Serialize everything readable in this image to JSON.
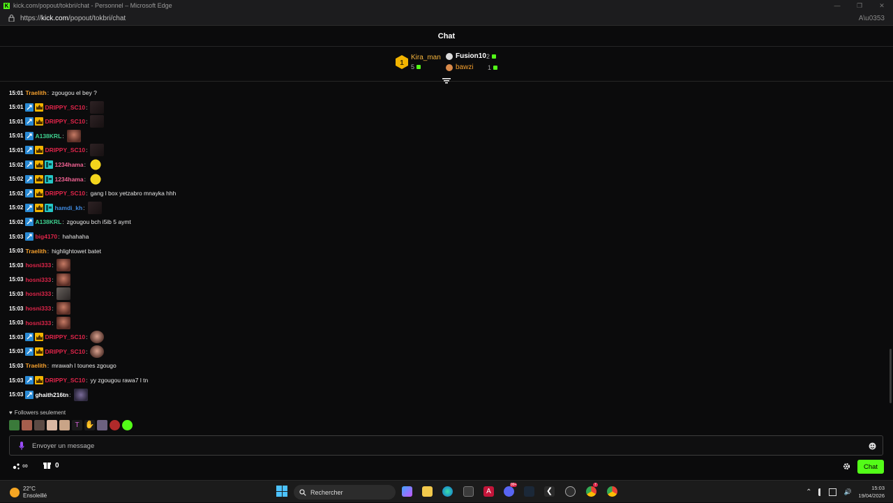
{
  "browser": {
    "title": "kick.com/popout/tokbri/chat - Personnel – Microsoft Edge",
    "url_prefix": "https://",
    "url_host": "kick.com",
    "url_path": "/popout/tokbri/chat",
    "read_aloud": "A͓"
  },
  "header": {
    "title": "Chat"
  },
  "podium": {
    "first": {
      "rank": "1",
      "name": "Kira_man",
      "value": "5"
    },
    "second": {
      "name": "Fusion10",
      "value": "2"
    },
    "third": {
      "name": "bawzi",
      "value": "1"
    }
  },
  "messages": [
    {
      "time": "15:01",
      "badges": [],
      "user": "Traelith",
      "color": "#f6a02d",
      "text": "zgougou el bey ?",
      "emote": null
    },
    {
      "time": "15:01",
      "badges": [
        "mod",
        "sub"
      ],
      "user": "DRIPPY_SC10",
      "color": "#e0254a",
      "text": "",
      "emote": "dark"
    },
    {
      "time": "15:01",
      "badges": [
        "mod",
        "sub"
      ],
      "user": "DRIPPY_SC10",
      "color": "#e0254a",
      "text": "",
      "emote": "dark"
    },
    {
      "time": "15:01",
      "badges": [
        "mod"
      ],
      "user": "A138KRL",
      "color": "#3ecf8e",
      "text": "",
      "emote": "face"
    },
    {
      "time": "15:01",
      "badges": [
        "mod",
        "sub"
      ],
      "user": "DRIPPY_SC10",
      "color": "#e0254a",
      "text": "",
      "emote": "dark"
    },
    {
      "time": "15:02",
      "badges": [
        "mod",
        "sub",
        "tea"
      ],
      "user": "1234hama",
      "color": "#f06292",
      "text": "",
      "emote": "yel"
    },
    {
      "time": "15:02",
      "badges": [
        "mod",
        "sub",
        "tea"
      ],
      "user": "1234hama",
      "color": "#f06292",
      "text": "",
      "emote": "yel"
    },
    {
      "time": "15:02",
      "badges": [
        "mod",
        "sub"
      ],
      "user": "DRIPPY_SC10",
      "color": "#e0254a",
      "text": "gang l box yetzabro mnayka hhh",
      "emote": null
    },
    {
      "time": "15:02",
      "badges": [
        "mod",
        "sub",
        "tea"
      ],
      "user": "hamdi_kh",
      "color": "#3f8ae0",
      "text": "",
      "emote": "dark"
    },
    {
      "time": "15:02",
      "badges": [
        "mod"
      ],
      "user": "A138KRL",
      "color": "#3ecf8e",
      "text": "zgougou bch i5ib 5 aymt",
      "emote": null
    },
    {
      "time": "15:03",
      "badges": [
        "mod"
      ],
      "user": "big4170",
      "color": "#e0254a",
      "text": "hahahaha",
      "emote": null
    },
    {
      "time": "15:03",
      "badges": [],
      "user": "Traelith",
      "color": "#f6a02d",
      "text": "highlightowet batet",
      "emote": null
    },
    {
      "time": "15:03",
      "badges": [],
      "user": "hosni333",
      "color": "#e0254a",
      "text": "",
      "emote": "face"
    },
    {
      "time": "15:03",
      "badges": [],
      "user": "hosni333",
      "color": "#e0254a",
      "text": "",
      "emote": "face"
    },
    {
      "time": "15:03",
      "badges": [],
      "user": "hosni333",
      "color": "#e0254a",
      "text": "",
      "emote": "gray"
    },
    {
      "time": "15:03",
      "badges": [],
      "user": "hosni333",
      "color": "#e0254a",
      "text": "",
      "emote": "face"
    },
    {
      "time": "15:03",
      "badges": [],
      "user": "hosni333",
      "color": "#e0254a",
      "text": "",
      "emote": "face"
    },
    {
      "time": "15:03",
      "badges": [
        "mod",
        "sub"
      ],
      "user": "DRIPPY_SC10",
      "color": "#e0254a",
      "text": "",
      "emote": "bust"
    },
    {
      "time": "15:03",
      "badges": [
        "mod",
        "sub"
      ],
      "user": "DRIPPY_SC10",
      "color": "#e0254a",
      "text": "",
      "emote": "bust"
    },
    {
      "time": "15:03",
      "badges": [],
      "user": "Traelith",
      "color": "#f6a02d",
      "text": "mrawah l tounes zgougo",
      "emote": null
    },
    {
      "time": "15:03",
      "badges": [
        "mod",
        "sub"
      ],
      "user": "DRIPPY_SC10",
      "color": "#e0254a",
      "text": "yy zgougou rawa7 l tn",
      "emote": null
    },
    {
      "time": "15:03",
      "badges": [
        "mod"
      ],
      "user": "ghaith216tn",
      "color": "#ffffff",
      "text": "",
      "emote": "pur"
    }
  ],
  "footer": {
    "followers_label": "Followers seulement",
    "input_placeholder": "Envoyer un message",
    "points_symbol": "∞",
    "box_count": "0",
    "chat_button": "Chat"
  },
  "taskbar": {
    "temperature": "22°C",
    "weather": "Ensoleillé",
    "search_placeholder": "Rechercher",
    "time": "15:03",
    "date": "19/04/2026",
    "badge_discord": "99+",
    "badge_chrome": "7"
  },
  "colors": {
    "accent": "#53fc18",
    "background": "#0b0b0c"
  }
}
